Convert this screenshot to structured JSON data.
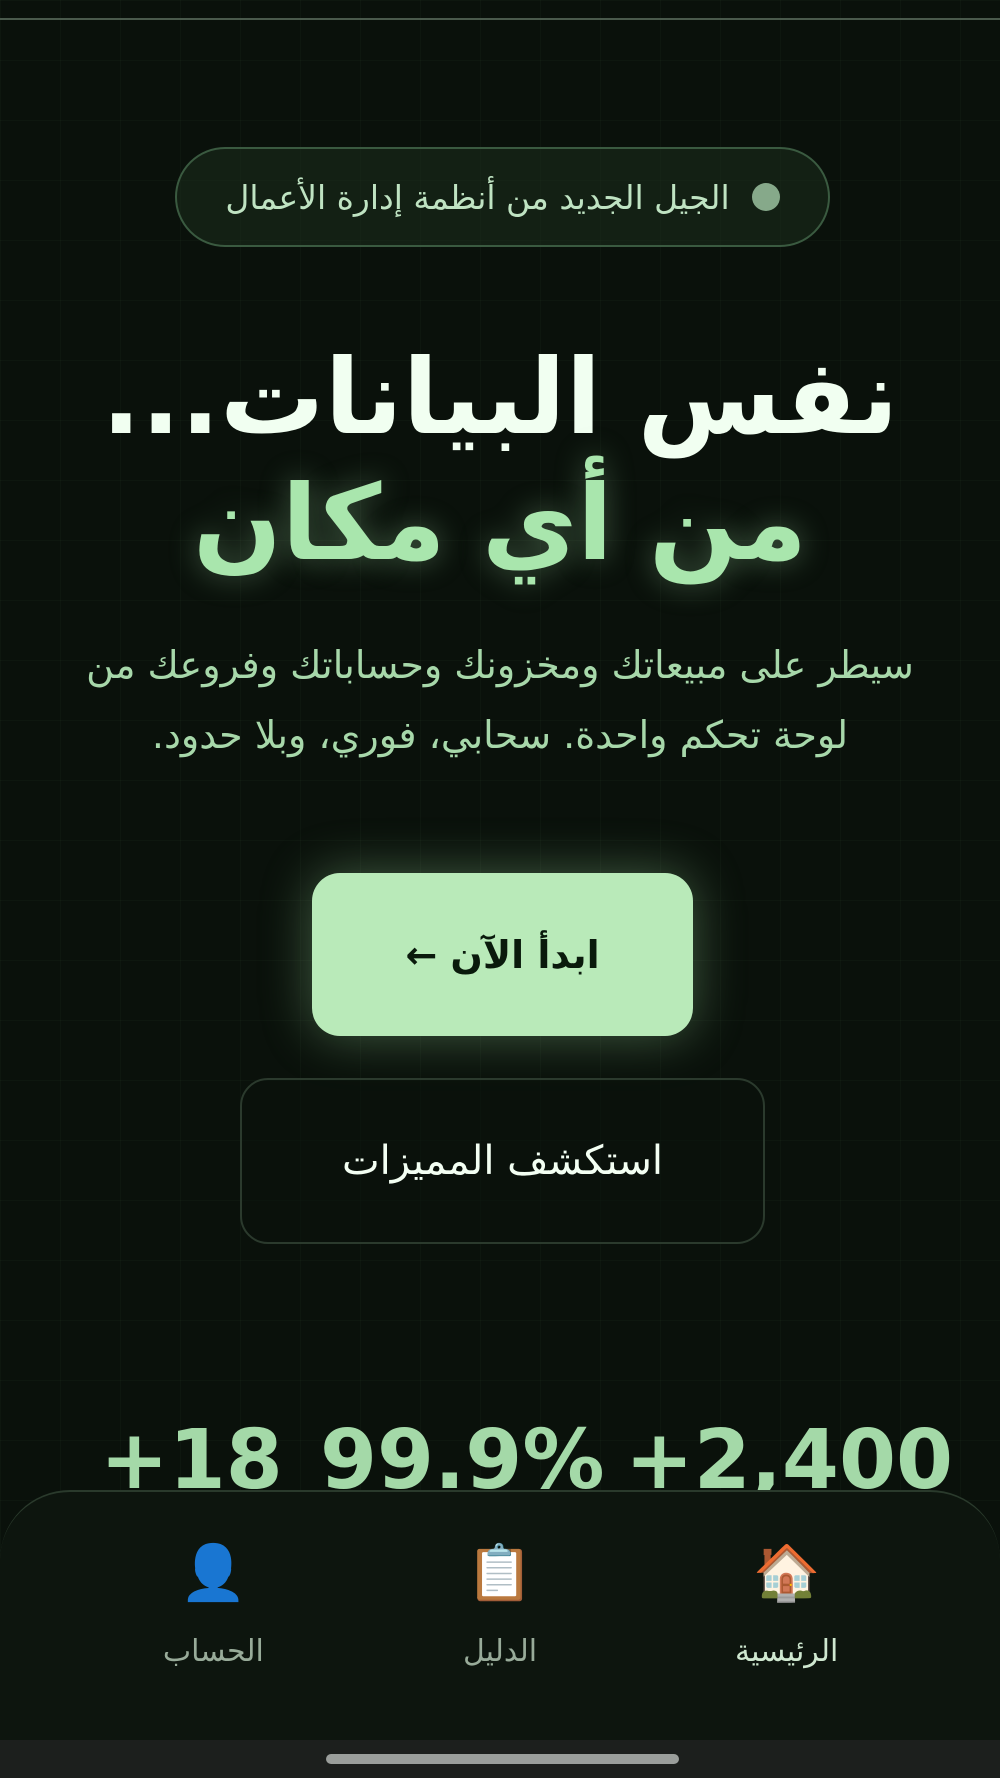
{
  "badge": {
    "text": "الجيل الجديد من أنظمة إدارة الأعمال"
  },
  "hero": {
    "line1": "نفس البيانات...",
    "line2": "من أي مكان"
  },
  "subtitle": {
    "line1": "سيطر على مبيعاتك ومخزونك وحساباتك وفروعك من",
    "line2": "لوحة تحكم واحدة. سحابي، فوري، وبلا حدود."
  },
  "cta": {
    "label": "ابدأ الآن ←"
  },
  "secondary": {
    "label": "استكشف المميزات"
  },
  "stats": [
    "+2,400",
    "99.9%",
    "+18"
  ],
  "nav": {
    "items": [
      {
        "label": "الرئيسية",
        "icon": "🏠",
        "icon_name": "home-icon",
        "active": true
      },
      {
        "label": "الدليل",
        "icon": "📋",
        "icon_name": "clipboard-icon",
        "active": false
      },
      {
        "label": "الحساب",
        "icon": "👤",
        "icon_name": "account-icon",
        "active": false
      }
    ]
  },
  "colors": {
    "background": "#0a110b",
    "accent": "#b9eab9",
    "accent_text": "#a9e6ad"
  }
}
